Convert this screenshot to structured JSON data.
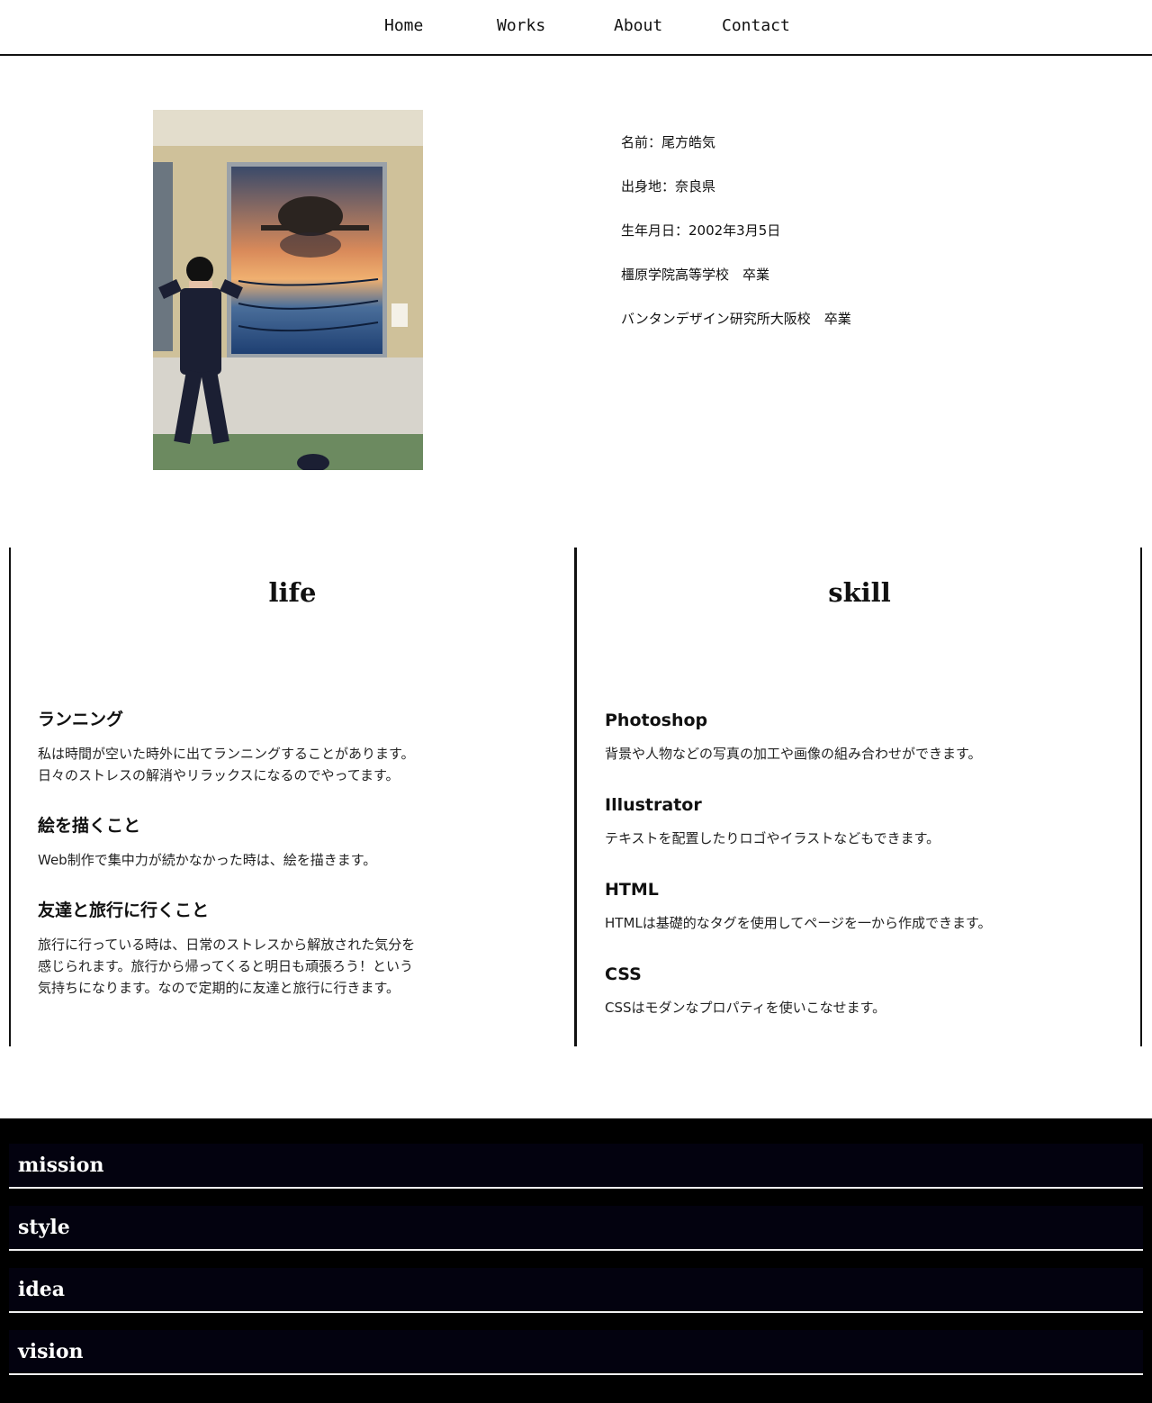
{
  "nav": {
    "home": "Home",
    "works": "Works",
    "about": "About",
    "contact": "Contact"
  },
  "profile": {
    "name": "名前：尾方皓気",
    "birthplace": "出身地：奈良県",
    "birthday": "生年月日：2002年3月5日",
    "high_school": "橿原学院高等学校　卒業",
    "college": "バンタンデザイン研究所大阪校　卒業"
  },
  "life": {
    "title": "life",
    "items": [
      {
        "heading": "ランニング",
        "text": "私は時間が空いた時外に出てランニングすることがあります。\n日々のストレスの解消やリラックスになるのでやってます。"
      },
      {
        "heading": "絵を描くこと",
        "text": "Web制作で集中力が続かなかった時は、絵を描きます。"
      },
      {
        "heading": "友達と旅行に行くこと",
        "text": "旅行に行っている時は、日常のストレスから解放された気分を\n感じられます。旅行から帰ってくると明日も頑張ろう！という\n気持ちになります。なので定期的に友達と旅行に行きます。"
      }
    ]
  },
  "skill": {
    "title": "skill",
    "items": [
      {
        "heading": "Photoshop",
        "text": "背景や人物などの写真の加工や画像の組み合わせができます。"
      },
      {
        "heading": "Illustrator",
        "text": "テキストを配置したりロゴやイラストなどもできます。"
      },
      {
        "heading": "HTML",
        "text": "HTMLは基礎的なタグを使用してページを一から作成できます。"
      },
      {
        "heading": "CSS",
        "text": "CSSはモダンなプロパティを使いこなせます。"
      }
    ]
  },
  "footer": {
    "items": [
      "mission",
      "style",
      "idea",
      "vision"
    ]
  },
  "colors": {
    "text": "#111111",
    "rule": "#111111",
    "footer_bg": "#000000",
    "footer_row": "#03020f",
    "footer_text": "#ffffff"
  }
}
